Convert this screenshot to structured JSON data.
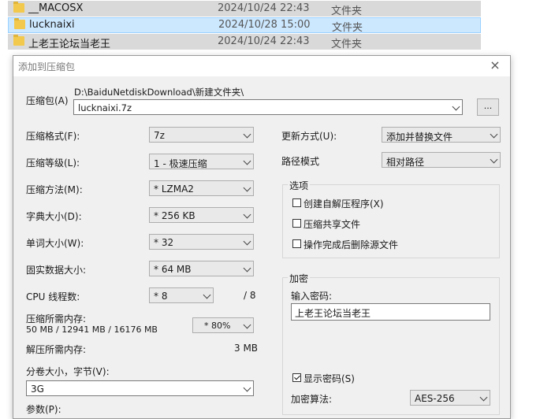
{
  "files": [
    {
      "name": "__MACOSX",
      "date": "2024/10/24 22:43",
      "type": "文件夹",
      "selected": false
    },
    {
      "name": "lucknaixi",
      "date": "2024/10/28 15:00",
      "type": "文件夹",
      "selected": true
    },
    {
      "name": "上老王论坛当老王",
      "date": "2024/10/24 22:43",
      "type": "文件夹",
      "selected": false
    }
  ],
  "dialog": {
    "title": "添加到压缩包",
    "close": "×",
    "archive_label": "压缩包(A)",
    "archive_path": "D:\\BaiduNetdiskDownload\\新建文件夹\\",
    "archive_name": "lucknaixi.7z",
    "browse": "...",
    "format_label": "压缩格式(F):",
    "format_value": "7z",
    "level_label": "压缩等级(L):",
    "level_value": "1 - 极速压缩",
    "method_label": "压缩方法(M):",
    "method_value": "* LZMA2",
    "dict_label": "字典大小(D):",
    "dict_value": "* 256 KB",
    "word_label": "单词大小(W):",
    "word_value": "* 32",
    "solid_label": "固实数据大小:",
    "solid_value": "* 64 MB",
    "cpu_label": "CPU 线程数:",
    "cpu_value": "* 8",
    "cpu_max": "/ 8",
    "mem_label": "压缩所需内存:",
    "mem_detail": "50 MB / 12941 MB / 16176 MB",
    "mem_value": "* 80%",
    "decomp_label": "解压所需内存:",
    "decomp_value": "3 MB",
    "split_label": "分卷大小，字节(V):",
    "split_value": "3G",
    "params_label": "参数(P):",
    "update_label": "更新方式(U):",
    "update_value": "添加并替换文件",
    "path_label": "路径模式",
    "path_value": "相对路径",
    "options_label": "选项",
    "opt_sfx": "创建自解压程序(X)",
    "opt_shared": "压缩共享文件",
    "opt_delete": "操作完成后删除源文件",
    "encrypt_label": "加密",
    "password_label": "输入密码:",
    "password_value": "上老王论坛当老王",
    "show_password": "显示密码(S)",
    "encrypt_method_label": "加密算法:",
    "encrypt_method_value": "AES-256"
  },
  "colors": {
    "selected_row": "#cce8ff",
    "selected_border": "#99d1ff",
    "gray_row": "#d9d9d9",
    "dialog_bg": "#f0f0f0"
  }
}
